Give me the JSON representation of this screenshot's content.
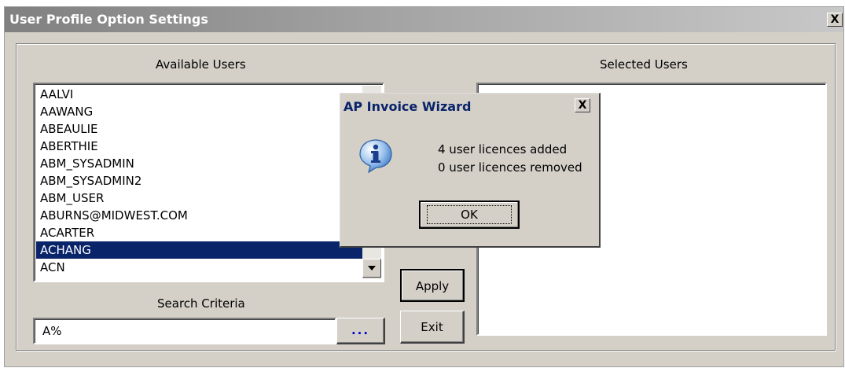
{
  "window": {
    "title": "User Profile Option Settings",
    "close_glyph": "X"
  },
  "available": {
    "label": "Available Users",
    "items": [
      "AALVI",
      "AAWANG",
      "ABEAULIE",
      "ABERTHIE",
      "ABM_SYSADMIN",
      "ABM_SYSADMIN2",
      "ABM_USER",
      "ABURNS@MIDWEST.COM",
      "ACARTER",
      "ACHANG",
      "ACN"
    ],
    "selected_item": "ACHANG"
  },
  "selected": {
    "label": "Selected Users"
  },
  "search": {
    "label": "Search Criteria",
    "value": "A%",
    "browse_label": "..."
  },
  "buttons": {
    "apply": "Apply",
    "exit": "Exit"
  },
  "dialog": {
    "title": "AP Invoice Wizard",
    "close_glyph": "X",
    "icon": "info-icon",
    "line1": "4 user licences added",
    "line2": "0 user licences removed",
    "ok": "OK"
  },
  "colors": {
    "selection": "#0a246a",
    "face": "#d4d0c8",
    "browse_text": "#0000cc"
  }
}
